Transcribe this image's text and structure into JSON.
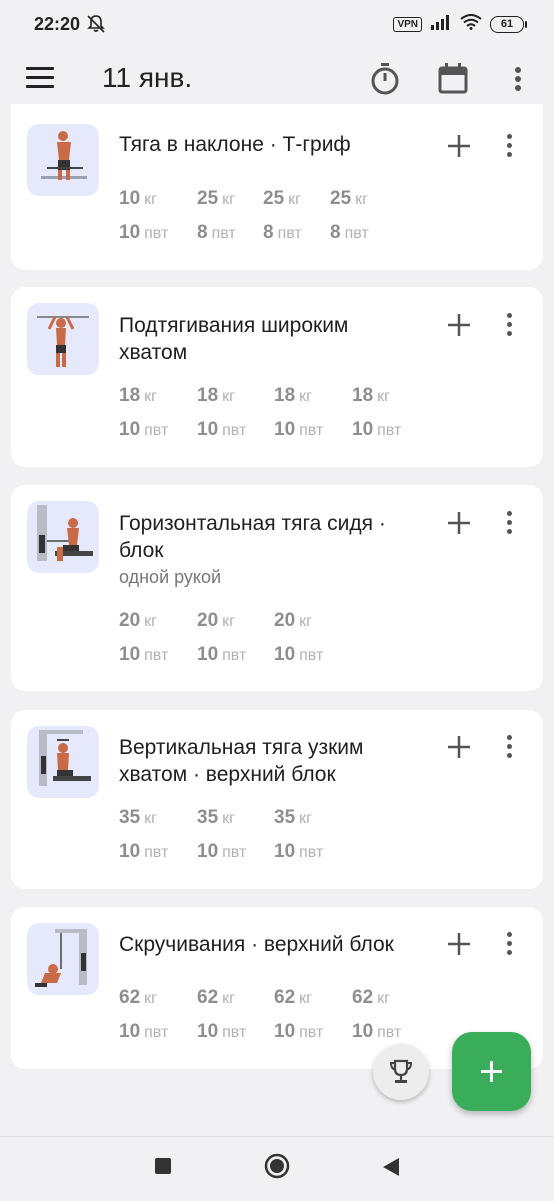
{
  "status_bar": {
    "time": "22:20",
    "vpn": "VPN",
    "battery": "61",
    "icons": [
      "bell-off-icon",
      "signal-icon",
      "wifi-icon",
      "battery-icon"
    ]
  },
  "app_bar": {
    "title": "11 янв.",
    "icons": [
      "menu-icon",
      "stopwatch-icon",
      "calendar-icon",
      "more-vert-icon"
    ]
  },
  "exercises": [
    {
      "title": "Тяга в наклоне · Т-гриф",
      "subtitle": "",
      "sets": [
        {
          "weight": "10",
          "reps": "10"
        },
        {
          "weight": "25",
          "reps": "8"
        },
        {
          "weight": "25",
          "reps": "8"
        },
        {
          "weight": "25",
          "reps": "8"
        }
      ]
    },
    {
      "title": "Подтягивания широким хватом",
      "subtitle": "",
      "sets": [
        {
          "weight": "18",
          "reps": "10"
        },
        {
          "weight": "18",
          "reps": "10"
        },
        {
          "weight": "18",
          "reps": "10"
        },
        {
          "weight": "18",
          "reps": "10"
        }
      ]
    },
    {
      "title": "Горизонтальная тяга сидя · блок",
      "subtitle": "одной рукой",
      "sets": [
        {
          "weight": "20",
          "reps": "10"
        },
        {
          "weight": "20",
          "reps": "10"
        },
        {
          "weight": "20",
          "reps": "10"
        }
      ]
    },
    {
      "title": "Вертикальная тяга узким хватом · верхний блок",
      "subtitle": "",
      "sets": [
        {
          "weight": "35",
          "reps": "10"
        },
        {
          "weight": "35",
          "reps": "10"
        },
        {
          "weight": "35",
          "reps": "10"
        }
      ]
    },
    {
      "title": "Скручивания · верхний блок",
      "subtitle": "",
      "sets": [
        {
          "weight": "62",
          "reps": "10"
        },
        {
          "weight": "62",
          "reps": "10"
        },
        {
          "weight": "62",
          "reps": "10"
        },
        {
          "weight": "62",
          "reps": "10"
        }
      ]
    }
  ],
  "units": {
    "weight": "кг",
    "reps": "пвт"
  },
  "colors": {
    "accent": "#3aad5a",
    "background": "#f1f1f3",
    "card": "#ffffff",
    "thumb_bg": "#e6e9fb"
  },
  "fabs": {
    "trophy": "trophy-icon",
    "add": "plus-icon"
  },
  "nav_bar": [
    "recents-square-icon",
    "home-circle-icon",
    "back-triangle-icon"
  ]
}
